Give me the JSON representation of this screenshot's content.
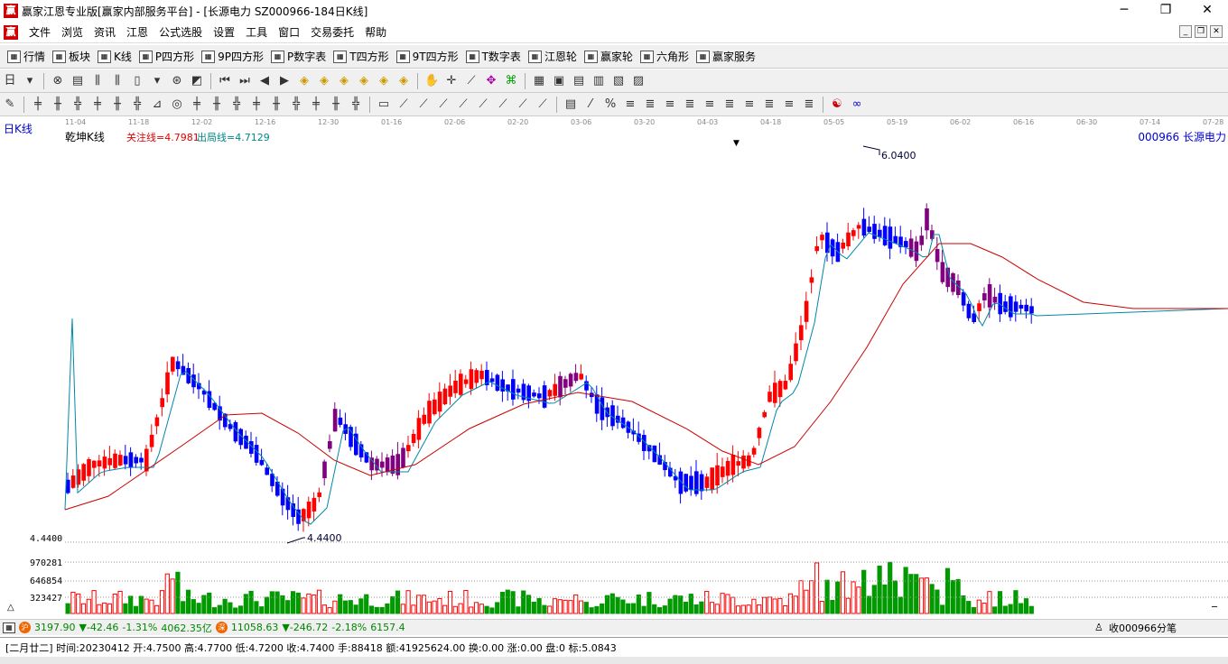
{
  "window": {
    "title": "赢家江恩专业版[赢家内部服务平台] - [长源电力  SZ000966-184日K线]",
    "logo": "赢",
    "min": "─",
    "max": "❐",
    "close": "✕"
  },
  "menu": {
    "logo": "赢",
    "items": [
      "文件",
      "浏览",
      "资讯",
      "江恩",
      "公式选股",
      "设置",
      "工具",
      "窗口",
      "交易委托",
      "帮助"
    ],
    "mdi": [
      "_",
      "❐",
      "✕"
    ]
  },
  "toolbar1": [
    {
      "icon": "table-icon",
      "label": "行情"
    },
    {
      "icon": "block-icon",
      "label": "板块"
    },
    {
      "icon": "candle-icon",
      "label": "K线"
    },
    {
      "icon": "p-icon",
      "label": "P四方形"
    },
    {
      "icon": "p9-icon",
      "label": "9P四方形"
    },
    {
      "icon": "pn-icon",
      "label": "P数字表"
    },
    {
      "icon": "ts-icon",
      "label": "T四方形"
    },
    {
      "icon": "t9-icon",
      "label": "9T四方形"
    },
    {
      "icon": "tn-icon",
      "label": "T数字表"
    },
    {
      "icon": "wheel-icon",
      "label": "江恩轮"
    },
    {
      "icon": "wheel2-icon",
      "label": "赢家轮"
    },
    {
      "icon": "hex-icon",
      "label": "六角形"
    },
    {
      "icon": "dollar-icon",
      "label": "赢家服务"
    }
  ],
  "chart_header": {
    "period": "日K线",
    "title": "乾坤K线",
    "focus": "关注线=4.7981",
    "exit": "出局线=4.7129",
    "stock": "000966  长源电力"
  },
  "date_ticks": [
    "11-04",
    "11-18",
    "12-02",
    "12-16",
    "12-30",
    "01-16",
    "02-06",
    "02-20",
    "03-06",
    "03-20",
    "04-03",
    "04-18",
    "05-05",
    "05-19",
    "06-02",
    "06-16",
    "06-30",
    "07-14",
    "07-28"
  ],
  "chart_data": {
    "type": "candlestick",
    "title": "乾坤K线",
    "high_label": "6.0400",
    "low_label": "4.4400",
    "price_axis_label": "4.4400",
    "volume_labels": [
      "970281",
      "646854",
      "323427"
    ]
  },
  "index_bar": {
    "sh_value": "3197.90",
    "sh_change": "▼-42.46",
    "sh_pct": "-1.31%",
    "sh_amount": "4062.35亿",
    "sz_value": "11058.63",
    "sz_change": "▼-246.72",
    "sz_pct": "-2.18%",
    "sz_amount": "6157.4",
    "mode": "收000966分笔"
  },
  "status": {
    "text": "[二月廿二] 时间:20230412 开:4.7500 高:4.7700 低:4.7200 收:4.7400 手:88418 额:41925624.00 换:0.00 涨:0.00 盘:0 标:5.0843"
  },
  "colors": {
    "up": "#ff0000",
    "down": "#0000ff",
    "purple": "#800080",
    "ma_short": "#0088aa",
    "ma_long": "#cc0000"
  }
}
